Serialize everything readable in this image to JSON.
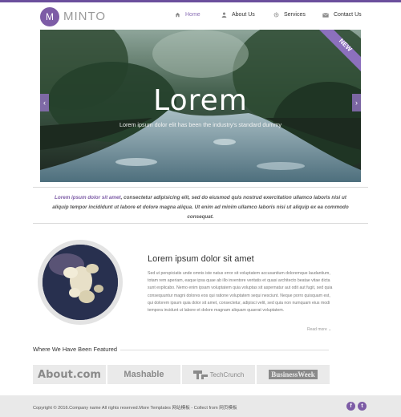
{
  "brand": {
    "logo_letter": "M",
    "name": "MINTO"
  },
  "nav": [
    {
      "label": "Home",
      "icon": "home-icon"
    },
    {
      "label": "About Us",
      "icon": "user-icon"
    },
    {
      "label": "Services",
      "icon": "gear-icon"
    },
    {
      "label": "Contact Us",
      "icon": "envelope-icon"
    }
  ],
  "hero": {
    "title": "Lorem",
    "subtitle": "Lorem ipsum dolor elit has been the industry's standard dummy",
    "badge": "NEW"
  },
  "intro": {
    "lead": "Lorem ipsum dolor sit amet",
    "text": ", consectetur adipisicing elit, sed do eiusmod quis nostrud exercitation ullamco laboris nisi ut aliquip tempor incididunt ut labore et dolore magna aliqua. Ut enim ad minim ullamco laboris nisi ut aliquip ex ea commodo consequat."
  },
  "feature": {
    "title": "Lorem ipsum dolor sit amet",
    "body": "Sed ut perspiciatis unde omnis iste natus error sit voluptatem accusantium doloremque laudantium, totam rem aperiam, eaque ipsa quae ab illo inventore veritatis et quasi architecto beatae vitae dicta sunt explicabo. Nemo enim ipsam voluptatem quia voluptas sit aspernatur aut odit aut fugit, sed quia consequuntur magni dolores eos qui ratione voluptatem sequi nesciunt. Neque porro quisquam est, qui dolorem ipsum quia dolor sit amet, consectetur, adipisci velit, sed quia non numquam eius modi tempora incidunt ut labore et dolore magnam aliquam quaerat voluptatem.",
    "read_more": "Read more ⌄"
  },
  "featured": {
    "heading": "Where We Have Been Featured",
    "partners": [
      "About.com",
      "Mashable",
      "TechCrunch",
      "BusinessWeek"
    ]
  },
  "footer": {
    "copyright": "Copyright © 2016.Company name All rights reserved.More Templates 网站模板 - Collect from 网页模板",
    "social": [
      "facebook-icon",
      "twitter-icon"
    ]
  },
  "colors": {
    "accent": "#7d5ca6",
    "topbar": "#6b4f9c",
    "footer_bg": "#e9e9e9"
  }
}
